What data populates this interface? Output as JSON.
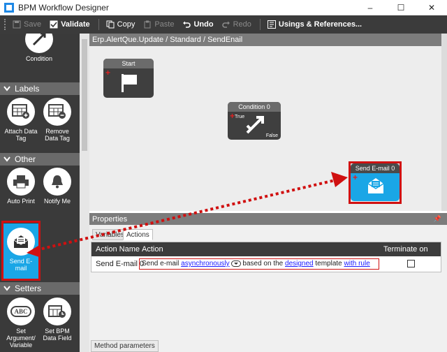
{
  "window": {
    "title": "BPM Workflow Designer",
    "controls": [
      "–",
      "☐",
      "✕"
    ]
  },
  "toolbar": {
    "save": "Save",
    "validate": "Validate",
    "copy": "Copy",
    "paste": "Paste",
    "undo": "Undo",
    "redo": "Redo",
    "usings": "Usings & References..."
  },
  "palette": {
    "condition": "Condition",
    "labels_header": "Labels",
    "attach_data_tag": "Attach Data Tag",
    "remove_data_tag": "Remove Data Tag",
    "other_header": "Other",
    "auto_print": "Auto Print",
    "notify_me": "Notify Me",
    "send_email": "Send E-mail",
    "setters_header": "Setters",
    "abc_glyph": "ABC",
    "set_argument": "Set Argument/ Variable",
    "set_bpm_field": "Set BPM Data Field"
  },
  "canvas": {
    "breadcrumb": "Erp.AlertQue.Update / Standard / SendEnail",
    "nodes": {
      "start": "Start",
      "condition": "Condition 0",
      "true_label": "True",
      "false_label": "False",
      "send_email": "Send E-mail 0"
    }
  },
  "properties": {
    "header": "Properties",
    "pin": "📌",
    "tabs": [
      "Variables",
      "Actions"
    ],
    "columns": [
      "Action Name",
      "Action",
      "Terminate on Error"
    ],
    "row": {
      "action_name": "Send E-mail 0",
      "action_parts": {
        "p1": "Send e-mail ",
        "link1": "asynchronously",
        "p2": " based on the ",
        "link2": "designed",
        "p3": " template ",
        "link3": "with rule"
      },
      "terminate_on_error": false
    },
    "bottom_tab": "Method parameters"
  },
  "colors": {
    "accent_blue": "#1aa6e6",
    "highlight_red": "#d01010"
  }
}
